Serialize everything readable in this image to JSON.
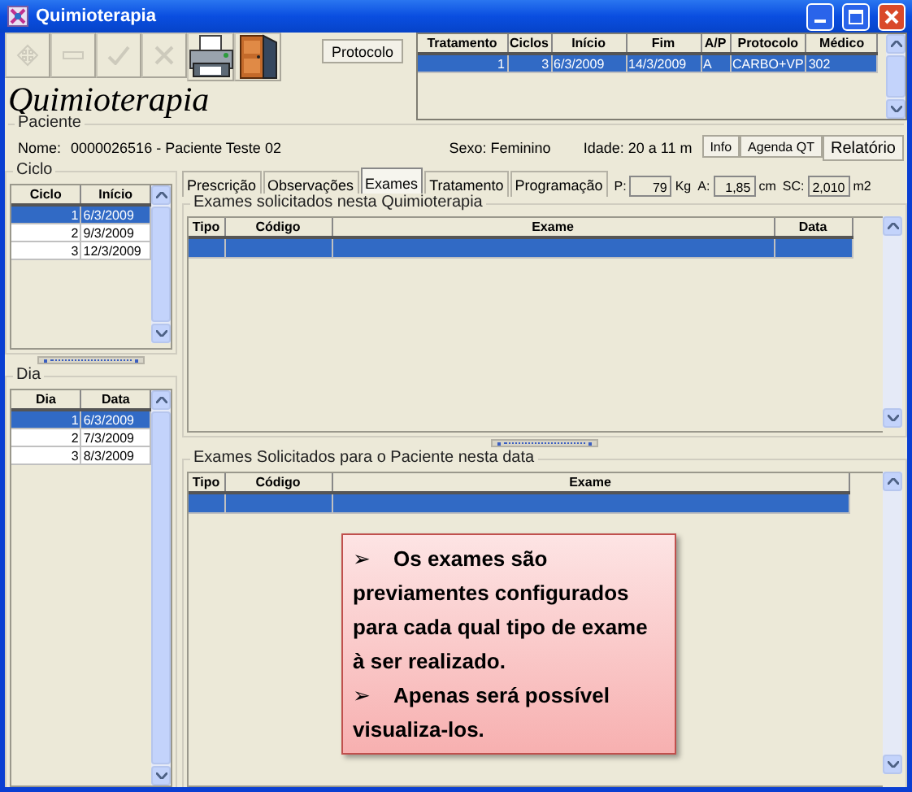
{
  "window": {
    "title": "Quimioterapia",
    "controls": [
      {
        "kind": "minimize"
      },
      {
        "kind": "maximize"
      },
      {
        "kind": "close"
      }
    ]
  },
  "toolbar": [
    {
      "kind": "arrows",
      "disabled": true
    },
    {
      "kind": "dash",
      "disabled": true
    },
    {
      "kind": "check",
      "disabled": true
    },
    {
      "kind": "cross",
      "disabled": true
    },
    {
      "kind": "printer",
      "disabled": false
    },
    {
      "kind": "exit",
      "disabled": false
    }
  ],
  "protocol_button": "Protocolo",
  "heading": "Quimioterapia",
  "treatments": {
    "columns": [
      "Tratamento",
      "Ciclos",
      "Início",
      "Fim",
      "A/P",
      "Protocolo",
      "Médico"
    ],
    "rows": [
      {
        "cells": [
          "1",
          "3",
          "6/3/2009",
          "14/3/2009",
          "A",
          "CARBO+VP",
          "302"
        ],
        "selected": true
      }
    ]
  },
  "patient": {
    "title": "Paciente",
    "name_label": "Nome:",
    "name": "0000026516 - Paciente Teste 02",
    "sex": "Sexo: Feminino",
    "age": "Idade: 20 a 11 m",
    "buttons": [
      "Info",
      "Agenda QT",
      "Relatório"
    ]
  },
  "cycles": {
    "title": "Ciclo",
    "columns": [
      "Ciclo",
      "Início"
    ],
    "rows": [
      {
        "cells": [
          "1",
          "6/3/2009"
        ],
        "selected": true
      },
      {
        "cells": [
          "2",
          "9/3/2009"
        ],
        "selected": false
      },
      {
        "cells": [
          "3",
          "12/3/2009"
        ],
        "selected": false
      }
    ]
  },
  "days": {
    "title": "Dia",
    "columns": [
      "Dia",
      "Data"
    ],
    "rows": [
      {
        "cells": [
          "1",
          "6/3/2009"
        ],
        "selected": true
      },
      {
        "cells": [
          "2",
          "7/3/2009"
        ],
        "selected": false
      },
      {
        "cells": [
          "3",
          "8/3/2009"
        ],
        "selected": false
      }
    ]
  },
  "tabs": [
    {
      "label": "Prescrição",
      "selected": false
    },
    {
      "label": "Observações",
      "selected": false
    },
    {
      "label": "Exames",
      "selected": true
    },
    {
      "label": "Tratamento",
      "selected": false
    },
    {
      "label": "Programação",
      "selected": false
    }
  ],
  "measures": [
    {
      "label": "P:",
      "value": "79",
      "unit": "Kg"
    },
    {
      "label": "A:",
      "value": "1,85",
      "unit": "cm"
    },
    {
      "label": "SC:",
      "value": "2,010",
      "unit": "m2"
    }
  ],
  "exams_treatment": {
    "title": "Exames solicitados nesta Quimioterapia",
    "columns": [
      "Tipo",
      "Código",
      "Exame",
      "Data"
    ],
    "rows": [
      {
        "selected": true
      }
    ]
  },
  "exams_patient": {
    "title": "Exames Solicitados para o Paciente nesta data",
    "columns": [
      "Tipo",
      "Código",
      "Exame"
    ],
    "rows": [
      {
        "selected": true
      }
    ]
  },
  "callout": [
    {
      "bullet": "➢",
      "text": "Os exames são previamentes configurados para cada qual tipo de exame à ser realizado."
    },
    {
      "bullet": "➢",
      "text": "Apenas será possível visualiza-los."
    }
  ]
}
